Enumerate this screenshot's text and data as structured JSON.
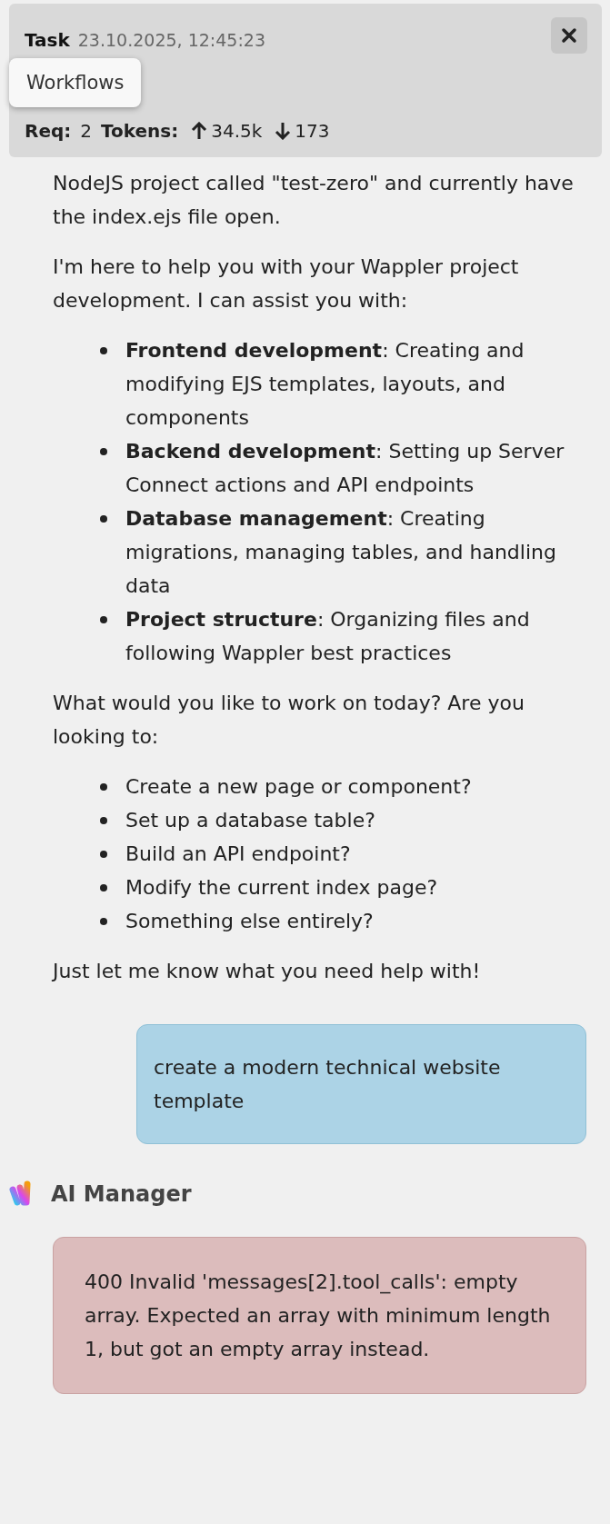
{
  "task_header": {
    "title": "Task",
    "timestamp": "23.10.2025, 12:45:23",
    "tooltip": "Workflows",
    "req_label": "Req:",
    "req_value": "2",
    "tokens_label": "Tokens:",
    "tokens_in": "34.5k",
    "tokens_out": "173"
  },
  "assistant_reply": [
    {
      "kind": "paragraph",
      "text": "NodeJS project called \"test-zero\" and currently have the index.ejs file open."
    },
    {
      "kind": "paragraph",
      "text": "I'm here to help you with your Wappler project development. I can assist you with:"
    },
    {
      "kind": "list",
      "items": [
        "**Frontend development**: Creating and modifying EJS templates, layouts, and components",
        "**Backend development**: Setting up Server Connect actions and API endpoints",
        "**Database management**: Creating migrations, managing tables, and handling data",
        "**Project structure**: Organizing files and following Wappler best practices"
      ]
    },
    {
      "kind": "paragraph",
      "text": "What would you like to work on today? Are you looking to:"
    },
    {
      "kind": "list",
      "items": [
        "Create a new page or component?",
        "Set up a database table?",
        "Build an API endpoint?",
        "Modify the current index page?",
        "Something else entirely?"
      ]
    },
    {
      "kind": "paragraph",
      "text": "Just let me know what you need help with!"
    }
  ],
  "user_message": "create a modern technical website template",
  "assistant_name": "AI Manager",
  "error_message": "400 Invalid 'messages[2].tool_calls': empty array. Expected an array with minimum length 1, but got an empty array instead."
}
